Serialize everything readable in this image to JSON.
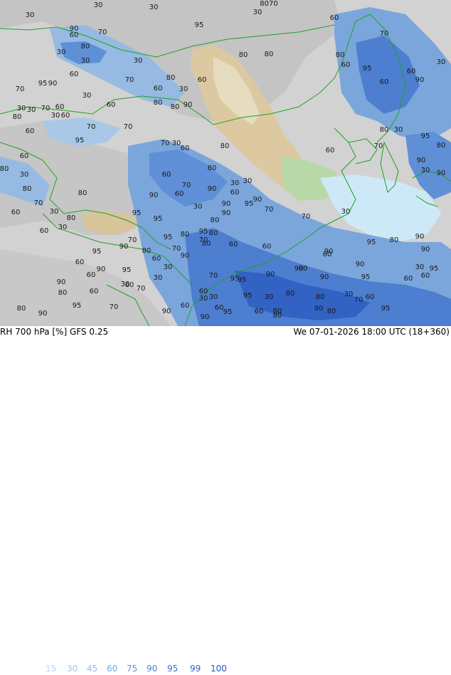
{
  "header": {
    "product": "RH 700 hPa [%] GFS 0.25",
    "valid_time": "We 07-01-2026 18:00 UTC (18+360)"
  },
  "legend": {
    "levels": [
      {
        "value": "15",
        "color": "#bcd6ee"
      },
      {
        "value": "30",
        "color": "#a9c8e8"
      },
      {
        "value": "45",
        "color": "#96bae2"
      },
      {
        "value": "60",
        "color": "#7aa6dc"
      },
      {
        "value": "75",
        "color": "#5f8fd6"
      },
      {
        "value": "90",
        "color": "#4d7ed0"
      },
      {
        "value": "95",
        "color": "#3f70cc"
      },
      {
        "value": "99",
        "color": "#3262c4"
      },
      {
        "value": "100",
        "color": "#2454bc"
      }
    ]
  },
  "map": {
    "colors": {
      "ocean_base": "#d5d5d5",
      "low_rh": "#c8c8c8",
      "dry_desert": "#dcc9a2",
      "dry_light": "#e6dcc0",
      "very_dry_green": "#b8d8a8",
      "light_cyan": "#cde9f7",
      "coast_lines": "#1fa21f"
    },
    "contour_labels": [
      "30",
      "30",
      "30",
      "30",
      "8070",
      "60",
      "90",
      "70",
      "60",
      "80",
      "95",
      "80",
      "30",
      "30",
      "80",
      "95",
      "30",
      "60",
      "80",
      "70",
      "90",
      "30",
      "60",
      "60",
      "30",
      "70",
      "80",
      "60",
      "80",
      "30",
      "30",
      "70",
      "60",
      "60",
      "80",
      "30",
      "90",
      "60",
      "70",
      "70",
      "95",
      "70",
      "30",
      "60",
      "80",
      "60",
      "80",
      "70",
      "60",
      "90",
      "30",
      "30",
      "60",
      "90",
      "70",
      "95",
      "90",
      "30",
      "80",
      "95",
      "80",
      "60",
      "60",
      "70",
      "30",
      "60",
      "80",
      "95",
      "60",
      "70",
      "60",
      "90",
      "30",
      "30",
      "80",
      "70",
      "60",
      "80",
      "95",
      "90",
      "30",
      "90",
      "60",
      "80",
      "30",
      "80",
      "70",
      "30",
      "80",
      "60",
      "30",
      "60",
      "80",
      "90",
      "95",
      "95",
      "70",
      "90",
      "80",
      "95",
      "80",
      "70",
      "60",
      "70",
      "90",
      "30",
      "60",
      "95",
      "60",
      "90",
      "95",
      "60",
      "30",
      "70",
      "70",
      "95",
      "90",
      "90",
      "60",
      "95",
      "80",
      "90",
      "90",
      "30",
      "95",
      "60",
      "60",
      "90",
      "95",
      "90",
      "80",
      "30",
      "60",
      "95",
      "80",
      "70",
      "90",
      "80",
      "60",
      "30",
      "60",
      "95",
      "95",
      "30",
      "80",
      "90",
      "80",
      "60",
      "80",
      "90",
      "95",
      "80",
      "90",
      "60",
      "30",
      "70",
      "90",
      "60",
      "90",
      "80",
      "30",
      "95",
      "80",
      "90"
    ]
  }
}
